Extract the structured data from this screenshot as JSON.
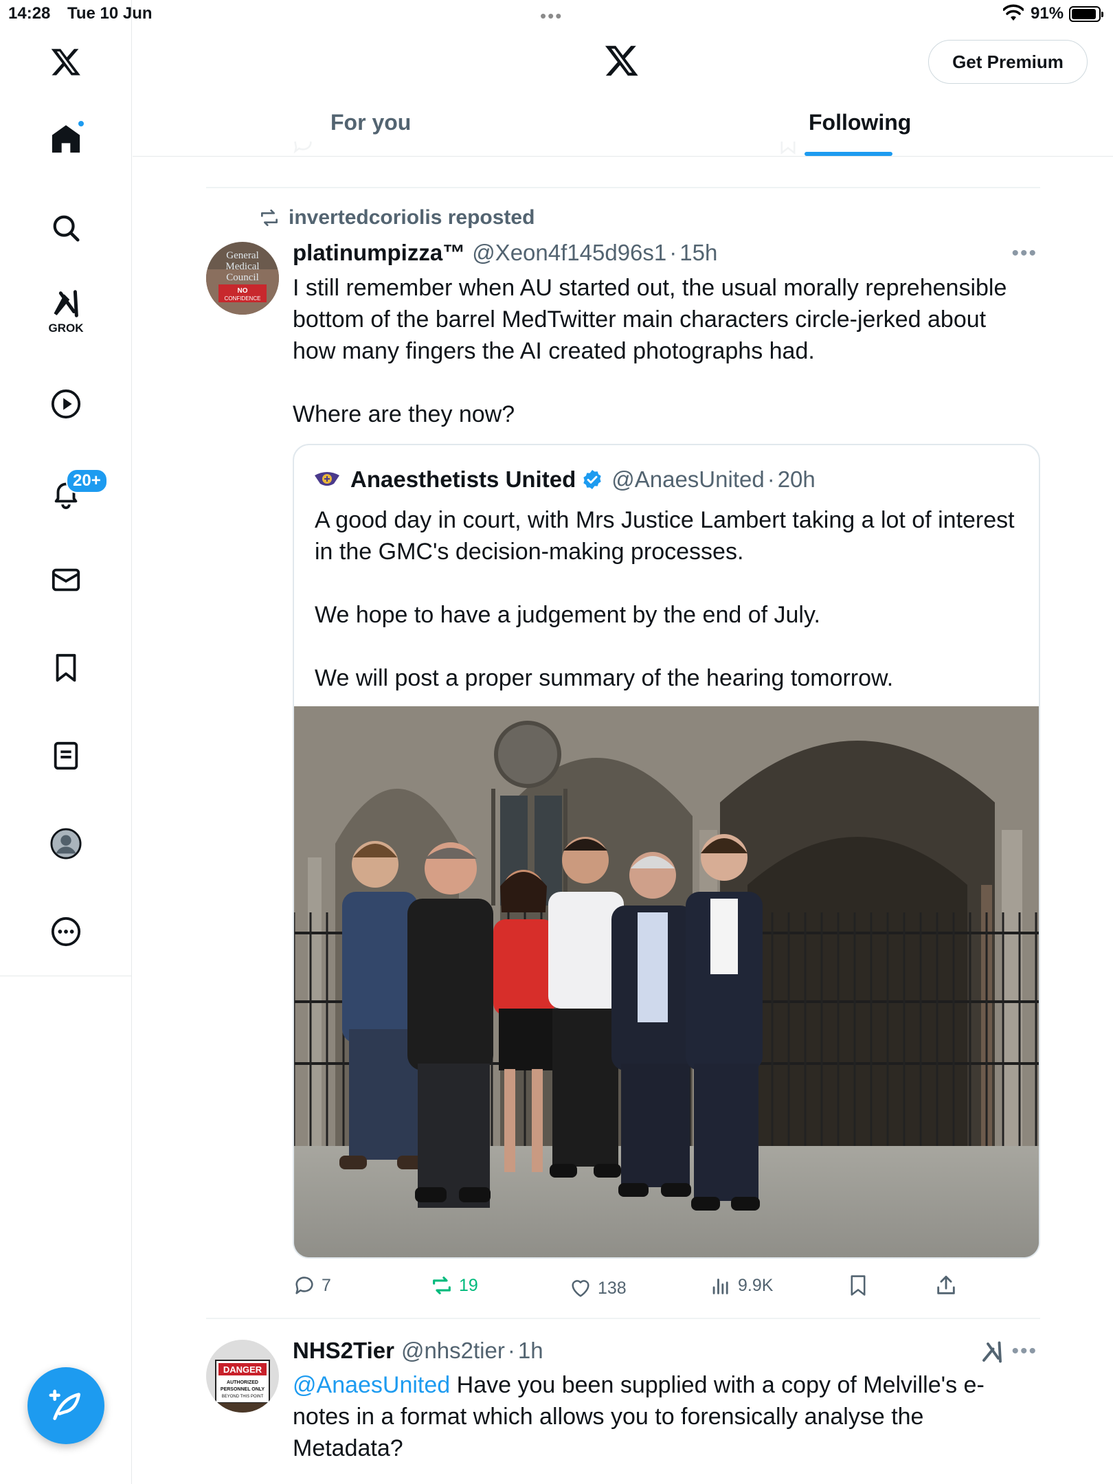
{
  "status_bar": {
    "time": "14:28",
    "date": "Tue 10 Jun",
    "battery_pct": "91%",
    "battery_level": 0.91
  },
  "sidebar": {
    "items": [
      {
        "name": "home",
        "icon": "home-icon",
        "has_dot": true
      },
      {
        "name": "search",
        "icon": "search-icon"
      },
      {
        "name": "grok",
        "icon": "grok-icon",
        "label": "GROK"
      },
      {
        "name": "videos",
        "icon": "play-icon"
      },
      {
        "name": "notifications",
        "icon": "bell-icon",
        "badge": "20+"
      },
      {
        "name": "messages",
        "icon": "mail-icon"
      },
      {
        "name": "bookmarks",
        "icon": "bookmark-icon"
      },
      {
        "name": "lists",
        "icon": "list-icon"
      },
      {
        "name": "profile",
        "icon": "profile-icon"
      },
      {
        "name": "more",
        "icon": "more-icon"
      }
    ],
    "compose_icon": "compose-icon"
  },
  "header": {
    "premium_label": "Get Premium",
    "tabs": [
      {
        "label": "For you",
        "active": false
      },
      {
        "label": "Following",
        "active": true
      }
    ]
  },
  "colors": {
    "accent": "#1d9bf0",
    "text_primary": "#0f1419",
    "text_secondary": "#536471",
    "repost_green": "#00ba7c"
  },
  "tweets": [
    {
      "repost_label": "invertedcoriolis reposted",
      "name": "platinumpizza™",
      "handle": "@Xeon4f145d96s1",
      "time": "15h",
      "avatar_text": [
        "General",
        "Medical",
        "Council",
        "NO",
        "CONFIDENCE"
      ],
      "text_lines": [
        "I still remember when AU started out, the usual morally reprehensible",
        "bottom of the barrel MedTwitter main characters circle-jerked about",
        "how many fingers the AI created photographs had.",
        "",
        "Where are they now?"
      ],
      "quote": {
        "name": "Anaesthetists United",
        "verified": true,
        "handle": "@AnaesUnited",
        "time": "20h",
        "text_lines": [
          "A good day in court, with Mrs Justice Lambert taking a lot of interest",
          "in the GMC's decision-making processes.",
          "",
          "We hope to have a judgement by the end of July.",
          "",
          "We will post a proper summary of the hearing tomorrow."
        ]
      },
      "actions": {
        "replies": "7",
        "reposts": "19",
        "likes": "138",
        "views": "9.9K",
        "reposted_by_me": true
      }
    },
    {
      "name": "NHS2Tier",
      "handle": "@nhs2tier",
      "time": "1h",
      "avatar_text": [
        "DANGER",
        "AUTHORIZED",
        "PERSONNEL ONLY",
        "BEYOND THIS POINT"
      ],
      "mention": "@AnaesUnited",
      "text_first": "Have you been supplied with a copy of Melville's e-",
      "text_lines": [
        "notes in a format which allows you to  forensically analyse the",
        "Metadata?"
      ]
    }
  ]
}
